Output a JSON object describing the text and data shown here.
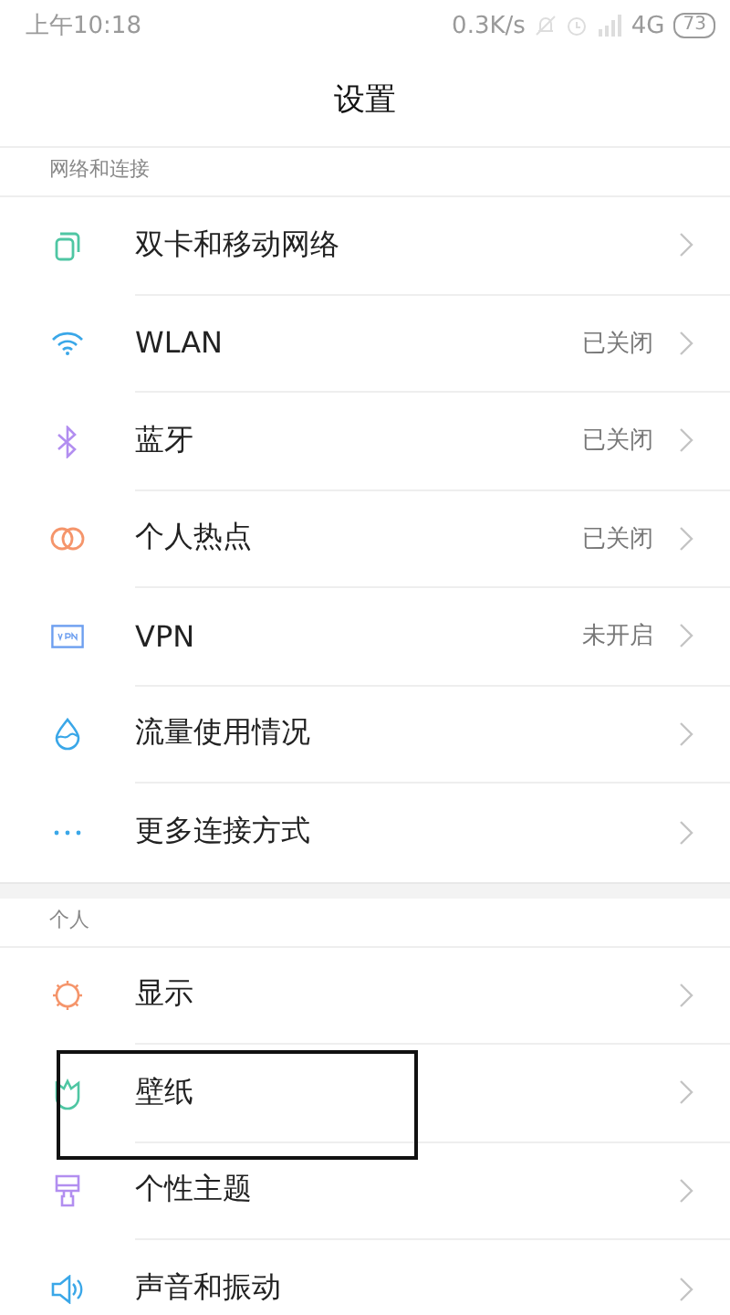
{
  "status_bar": {
    "time": "上午10:18",
    "speed": "0.3K/s",
    "network": "4G",
    "battery": "73"
  },
  "title": "设置",
  "sections": [
    {
      "header": "网络和连接",
      "items": [
        {
          "kind": "sim",
          "label": "双卡和移动网络",
          "highlighted": false
        },
        {
          "kind": "wifi",
          "label": "WLAN",
          "value": "已关闭",
          "highlighted": false
        },
        {
          "kind": "bluetooth",
          "label": "蓝牙",
          "value": "已关闭",
          "highlighted": false
        },
        {
          "kind": "hotspot",
          "label": "个人热点",
          "value": "已关闭",
          "highlighted": false
        },
        {
          "kind": "vpn",
          "label": "VPN",
          "value": "未开启",
          "highlighted": false
        },
        {
          "kind": "data",
          "label": "流量使用情况",
          "highlighted": false
        },
        {
          "kind": "more",
          "label": "更多连接方式",
          "highlighted": false
        }
      ]
    },
    {
      "header": "个人",
      "items": [
        {
          "kind": "display",
          "label": "显示",
          "highlighted": false
        },
        {
          "kind": "wallpaper",
          "label": "壁纸",
          "highlighted": true
        },
        {
          "kind": "theme",
          "label": "个性主题",
          "highlighted": false
        },
        {
          "kind": "sound",
          "label": "声音和振动",
          "highlighted": false
        }
      ]
    }
  ]
}
